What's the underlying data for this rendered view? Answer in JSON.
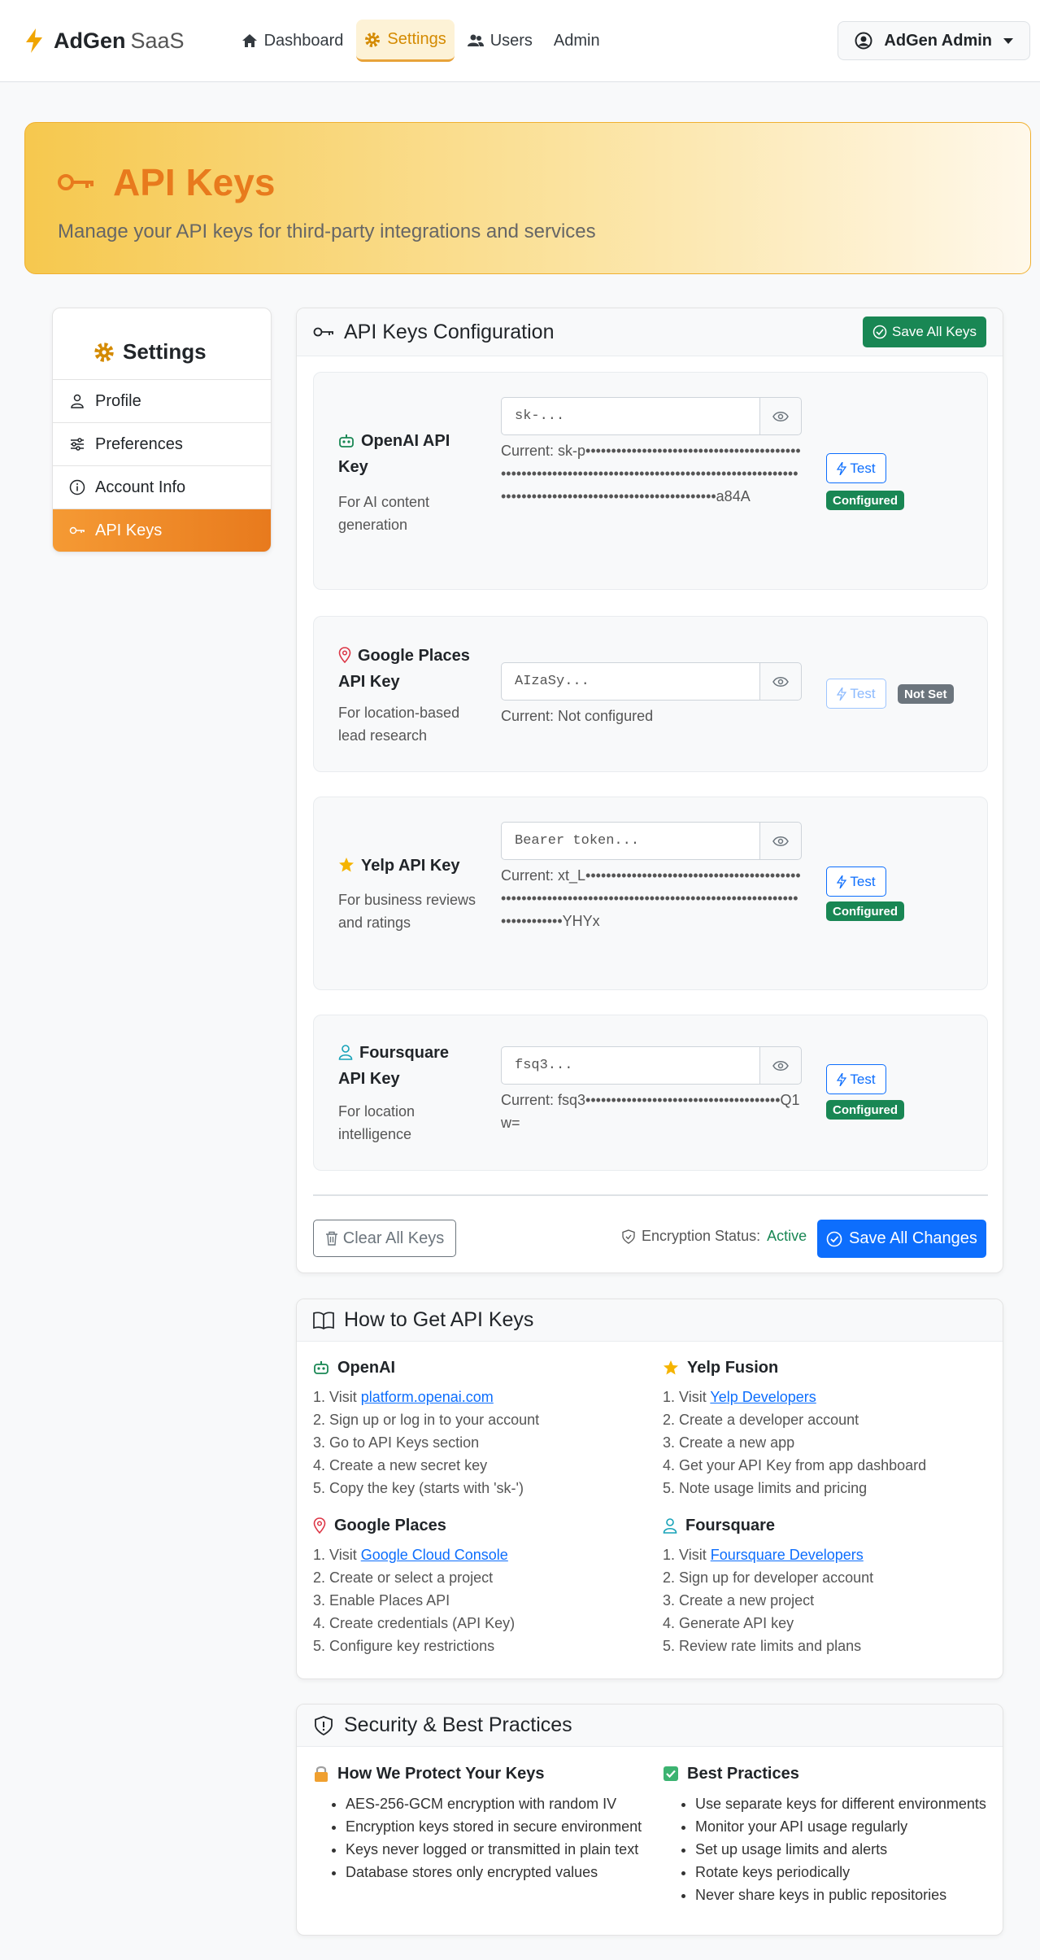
{
  "nav": {
    "brand_bold": "AdGen",
    "brand_light": "SaaS",
    "links": [
      {
        "label": "Dashboard",
        "icon": "home-icon"
      },
      {
        "label": "Settings",
        "icon": "gear-icon"
      },
      {
        "label": "Users",
        "icon": "users-icon"
      },
      {
        "label": "Admin",
        "icon": ""
      }
    ],
    "active_link": "Settings",
    "user": "AdGen Admin"
  },
  "hero": {
    "title": "API Keys",
    "subtitle": "Manage your API keys for third-party integrations and services"
  },
  "sidebar": {
    "title": "Settings",
    "items": [
      {
        "label": "Profile",
        "icon": "person-icon"
      },
      {
        "label": "Preferences",
        "icon": "sliders-icon"
      },
      {
        "label": "Account Info",
        "icon": "info-icon"
      },
      {
        "label": "API Keys",
        "icon": "key-icon"
      }
    ],
    "active_item": "API Keys"
  },
  "config": {
    "title": "API Keys Configuration",
    "save_all_keys": "Save All Keys",
    "keys": [
      {
        "name": "OpenAI API Key",
        "description": "For AI content generation",
        "placeholder": "sk-...",
        "current": "Current: sk-p••••••••••••••••••••••••••••••••••••••••••••••••••••••••••••••••••••••••••••••••••••••••••••••••••••••••••••••••••••••••••••••••••••••••••••••a84A",
        "test": "Test",
        "status": "Configured"
      },
      {
        "name": "Google Places API Key",
        "description": "For location-based lead research",
        "placeholder": "AIzaSy...",
        "current": "Current: Not configured",
        "test": "Test",
        "status": "Not Set"
      },
      {
        "name": "Yelp API Key",
        "description": "For business reviews and ratings",
        "placeholder": "Bearer token...",
        "current": "Current: xt_L••••••••••••••••••••••••••••••••••••••••••••••••••••••••••••••••••••••••••••••••••••••••••••••••••••••••••••••••YHYx",
        "test": "Test",
        "status": "Configured"
      },
      {
        "name": "Foursquare API Key",
        "description": "For location intelligence",
        "placeholder": "fsq3...",
        "current": "Current: fsq3••••••••••••••••••••••••••••••••••••••Q1w=",
        "test": "Test",
        "status": "Configured"
      }
    ],
    "clear_all": "Clear All Keys",
    "encryption_label": "Encryption Status:",
    "encryption_value": "Active",
    "save_all_changes": "Save All Changes"
  },
  "guide": {
    "title": "How to Get API Keys",
    "sections": [
      {
        "title": "OpenAI",
        "steps": [
          "1. Visit ",
          "2. Sign up or log in to your account",
          "3. Go to API Keys section",
          "4. Create a new secret key",
          "5. Copy the key (starts with 'sk-')"
        ],
        "link": "platform.openai.com"
      },
      {
        "title": "Yelp Fusion",
        "steps": [
          "1. Visit ",
          "2. Create a developer account",
          "3. Create a new app",
          "4. Get your API Key from app dashboard",
          "5. Note usage limits and pricing"
        ],
        "link": "Yelp Developers"
      },
      {
        "title": "Google Places",
        "steps": [
          "1. Visit ",
          "2. Create or select a project",
          "3. Enable Places API",
          "4. Create credentials (API Key)",
          "5. Configure key restrictions"
        ],
        "link": "Google Cloud Console"
      },
      {
        "title": "Foursquare",
        "steps": [
          "1. Visit ",
          "2. Sign up for developer account",
          "3. Create a new project",
          "4. Generate API key",
          "5. Review rate limits and plans"
        ],
        "link": "Foursquare Developers"
      }
    ]
  },
  "security": {
    "title": "Security & Best Practices",
    "protect_title": "How We Protect Your Keys",
    "protect_items": [
      "AES-256-GCM encryption with random IV",
      "Encryption keys stored in secure environment",
      "Keys never logged or transmitted in plain text",
      "Database stores only encrypted values"
    ],
    "best_title": "Best Practices",
    "best_items": [
      "Use separate keys for different environments",
      "Monitor your API usage regularly",
      "Set up usage limits and alerts",
      "Rotate keys periodically",
      "Never share keys in public repositories"
    ]
  },
  "colors": {
    "accent": "#e87a1d",
    "success": "#198754",
    "primary": "#0d6efd",
    "secondary": "#6c757d"
  }
}
